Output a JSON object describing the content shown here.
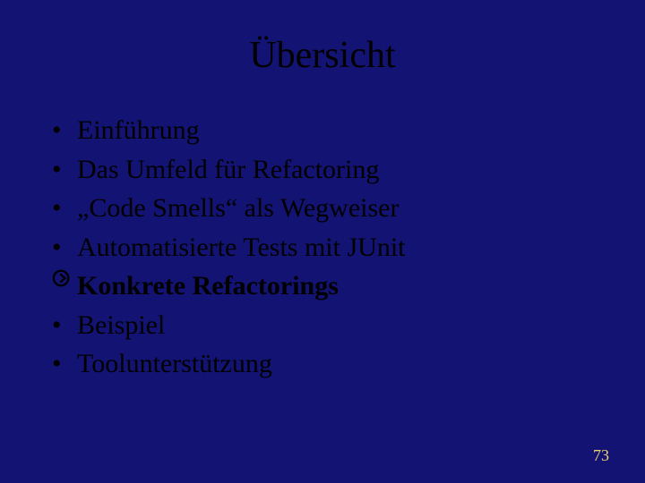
{
  "slide": {
    "title": "Übersicht",
    "bullets": [
      {
        "marker": "•",
        "text": "Einführung",
        "highlighted": false
      },
      {
        "marker": "•",
        "text": "Das Umfeld für Refactoring",
        "highlighted": false
      },
      {
        "marker": "•",
        "text": "„Code Smells“ als Wegweiser",
        "highlighted": false
      },
      {
        "marker": "•",
        "text": "Automatisierte Tests mit JUnit",
        "highlighted": false
      },
      {
        "marker": "arrow",
        "text": "Konkrete Refactorings",
        "highlighted": true
      },
      {
        "marker": "•",
        "text": "Beispiel",
        "highlighted": false
      },
      {
        "marker": "•",
        "text": "Toolunterstützung",
        "highlighted": false
      }
    ],
    "page_number": "73"
  }
}
